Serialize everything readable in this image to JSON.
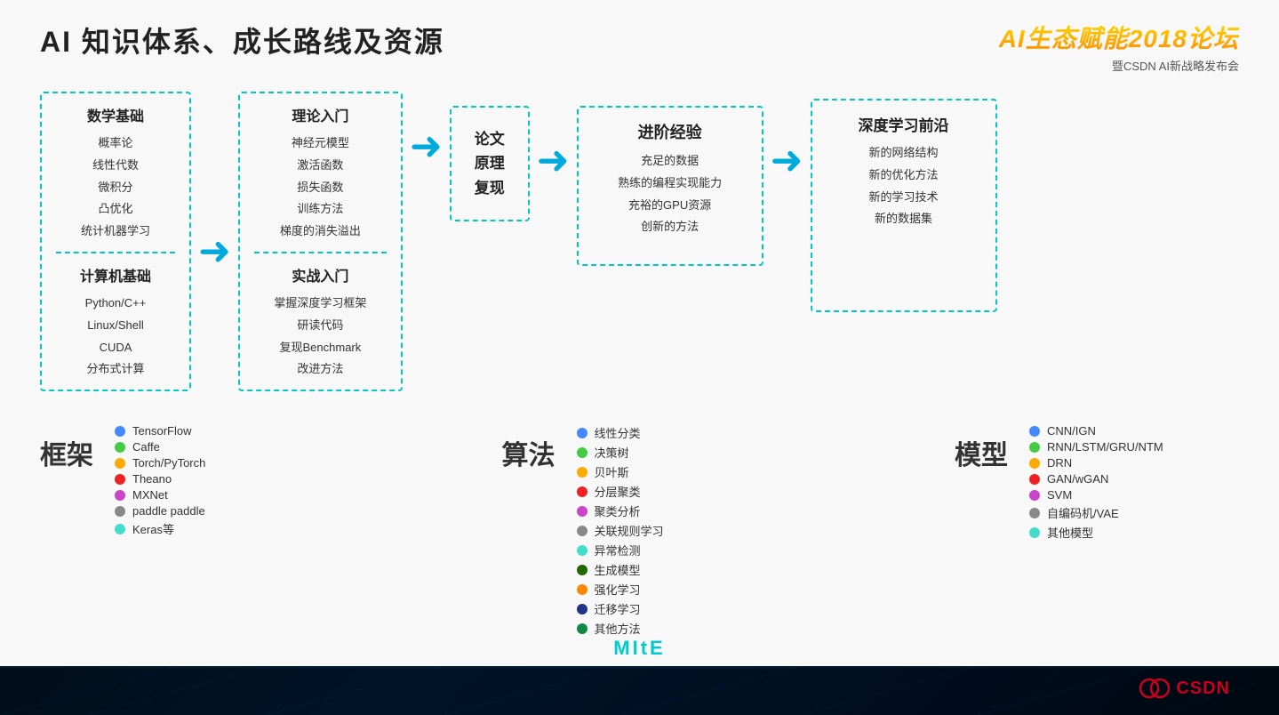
{
  "header": {
    "main_title": "AI 知识体系、成长路线及资源",
    "logo_title": "AI生态赋能2018论坛",
    "logo_subtitle": "暨CSDN AI新战略发布会"
  },
  "flow": {
    "box1": {
      "section1_title": "数学基础",
      "section1_items": [
        "概率论",
        "线性代数",
        "微积分",
        "凸优化",
        "统计机器学习"
      ],
      "section2_title": "计算机基础",
      "section2_items": [
        "Python/C++",
        "Linux/Shell",
        "CUDA",
        "分布式计算"
      ]
    },
    "box2": {
      "section1_title": "理论入门",
      "section1_items": [
        "神经元模型",
        "激活函数",
        "损失函数",
        "训练方法",
        "梯度的消失溢出"
      ],
      "section2_title": "实战入门",
      "section2_items": [
        "掌握深度学习框架",
        "研读代码",
        "复现Benchmark",
        "改进方法"
      ]
    },
    "box3": {
      "title": "论文",
      "subtitle1": "原理",
      "subtitle2": "复现"
    },
    "box4": {
      "title": "进阶经验",
      "items": [
        "充足的数据",
        "熟练的编程实现能力",
        "充裕的GPU资源",
        "创新的方法"
      ]
    },
    "box5": {
      "title": "深度学习前沿",
      "items": [
        "新的网络结构",
        "新的优化方法",
        "新的学习技术",
        "新的数据集"
      ]
    }
  },
  "framework": {
    "title": "框架",
    "items": [
      {
        "color": "#4488ff",
        "label": "TensorFlow"
      },
      {
        "color": "#44cc44",
        "label": "Caffe"
      },
      {
        "color": "#ffaa00",
        "label": "Torch/PyTorch"
      },
      {
        "color": "#ee2222",
        "label": "Theano"
      },
      {
        "color": "#cc44cc",
        "label": "MXNet"
      },
      {
        "color": "#888888",
        "label": "paddle paddle"
      },
      {
        "color": "#44ddcc",
        "label": "Keras等"
      }
    ]
  },
  "algorithm": {
    "title": "算法",
    "items": [
      {
        "color": "#4488ff",
        "label": "线性分类"
      },
      {
        "color": "#44cc44",
        "label": "决策树"
      },
      {
        "color": "#ffaa00",
        "label": "贝叶斯"
      },
      {
        "color": "#ee2222",
        "label": "分层聚类"
      },
      {
        "color": "#cc44cc",
        "label": "聚类分析"
      },
      {
        "color": "#888888",
        "label": "关联规则学习"
      },
      {
        "color": "#44ddcc",
        "label": "异常检测"
      },
      {
        "color": "#226600",
        "label": "生成模型"
      },
      {
        "color": "#ff8800",
        "label": "强化学习"
      },
      {
        "color": "#223388",
        "label": "迁移学习"
      },
      {
        "color": "#118844",
        "label": "其他方法"
      }
    ]
  },
  "model": {
    "title": "模型",
    "items": [
      {
        "color": "#4488ff",
        "label": "CNN/IGN"
      },
      {
        "color": "#44cc44",
        "label": "RNN/LSTM/GRU/NTM"
      },
      {
        "color": "#ffaa00",
        "label": "DRN"
      },
      {
        "color": "#ee2222",
        "label": "GAN/wGAN"
      },
      {
        "color": "#cc44cc",
        "label": "SVM"
      },
      {
        "color": "#888888",
        "label": "自编码机/VAE"
      },
      {
        "color": "#44ddcc",
        "label": "其他模型"
      }
    ]
  },
  "mite_text": "MItE",
  "csdn_label": "CSDN"
}
